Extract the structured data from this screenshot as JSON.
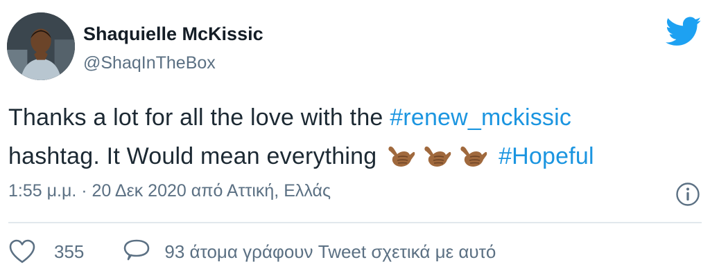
{
  "author": {
    "display_name": "Shaquielle McKissic",
    "handle": "@ShaqInTheBox"
  },
  "tweet": {
    "text_line1_prefix": "Thanks a lot for all the love with the ",
    "hashtag1": "#renew_mckissic",
    "text_line2": "hashtag. It Would mean everything",
    "emojis": [
      "call-me-hand",
      "call-me-hand",
      "call-me-hand"
    ],
    "hashtag2": "#Hopeful"
  },
  "meta": {
    "timestamp": "1:55 μ.μ. · 20 Δεκ 2020 από Αττική, Ελλάς"
  },
  "actions": {
    "like_count": "355",
    "reply_text": "93 άτομα γράφουν Tweet σχετικά με αυτό"
  },
  "colors": {
    "brand": "#1da1f2",
    "hashtag": "#1b95e0",
    "secondary_text": "#5b7083",
    "emoji_skin": "#a0693d"
  },
  "icons": {
    "logo": "twitter-bird-icon",
    "info": "info-icon",
    "like": "heart-icon",
    "reply": "speech-bubble-icon"
  }
}
